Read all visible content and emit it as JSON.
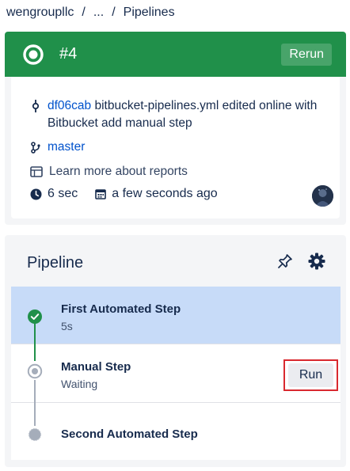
{
  "breadcrumb": {
    "workspace": "wengroupllc",
    "separator": "/",
    "ellipsis": "...",
    "current": "Pipelines"
  },
  "header": {
    "status_color": "#20904a",
    "status_icon": "in-progress-ring-icon",
    "build_number": "#4",
    "rerun_label": "Rerun"
  },
  "details": {
    "commit_hash": "df06cab",
    "commit_message": "bitbucket-pipelines.yml edited online with Bitbucket add manual step",
    "branch": "master",
    "reports_label": "Learn more about reports",
    "duration": "6 sec",
    "started": "a few seconds ago"
  },
  "pipeline": {
    "title": "Pipeline",
    "accent_color": "#c7dbf8",
    "steps": [
      {
        "name": "First Automated Step",
        "sub": "5s",
        "status": "success"
      },
      {
        "name": "Manual Step",
        "sub": "Waiting",
        "status": "pending",
        "action_label": "Run"
      },
      {
        "name": "Second Automated Step",
        "sub": "",
        "status": "not-run"
      }
    ]
  }
}
